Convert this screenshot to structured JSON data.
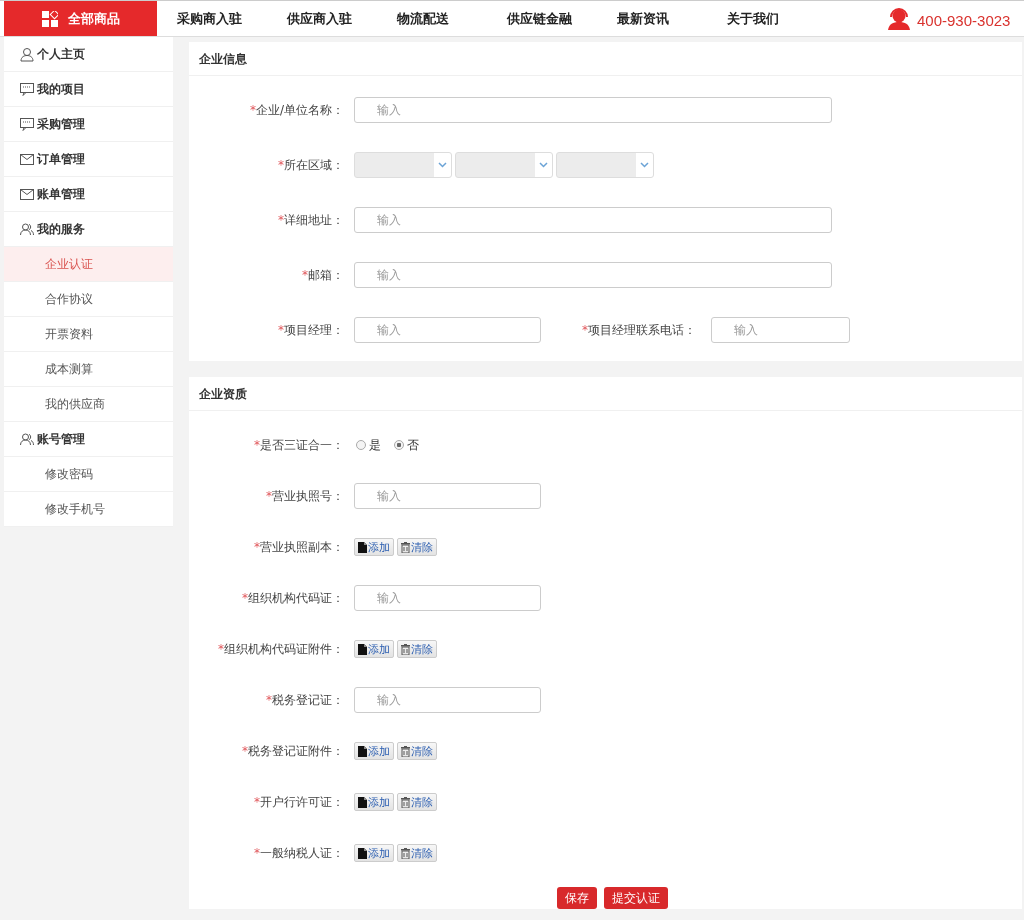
{
  "header": {
    "all_goods": "全部商品",
    "nav": [
      {
        "label": "采购商入驻"
      },
      {
        "label": "供应商入驻"
      },
      {
        "label": "物流配送"
      },
      {
        "label": "供应链金融"
      },
      {
        "label": "最新资讯"
      },
      {
        "label": "关于我们"
      }
    ],
    "phone": "400-930-3023"
  },
  "sidebar": {
    "items": [
      {
        "kind": "user",
        "label": "个人主页",
        "selected": false
      },
      {
        "kind": "board",
        "label": "我的项目",
        "selected": false
      },
      {
        "kind": "board",
        "label": "采购管理",
        "selected": false
      },
      {
        "kind": "mail",
        "label": "订单管理",
        "selected": false
      },
      {
        "kind": "mail",
        "label": "账单管理",
        "selected": false
      },
      {
        "kind": "team",
        "label": "我的服务",
        "selected": false
      },
      {
        "kind": "sub",
        "label": "企业认证",
        "selected": true
      },
      {
        "kind": "sub",
        "label": "合作协议",
        "selected": false
      },
      {
        "kind": "sub",
        "label": "开票资料",
        "selected": false
      },
      {
        "kind": "sub",
        "label": "成本测算",
        "selected": false
      },
      {
        "kind": "sub",
        "label": "我的供应商",
        "selected": false
      },
      {
        "kind": "team",
        "label": "账号管理",
        "selected": false
      },
      {
        "kind": "sub",
        "label": "修改密码",
        "selected": false
      },
      {
        "kind": "sub",
        "label": "修改手机号",
        "selected": false
      }
    ]
  },
  "sections": [
    {
      "title": "企业信息",
      "rows": [
        {
          "kind": "widetext",
          "mark": "*",
          "label": "企业/单位名称：",
          "placeholder": "输入"
        },
        {
          "kind": "selects",
          "mark": "*",
          "label": "所在区域：",
          "selects": [
            {
              "disabled": true
            },
            {
              "disabled": true
            },
            {
              "disabled": true
            }
          ]
        },
        {
          "kind": "widetext",
          "mark": "*",
          "label": "详细地址：",
          "placeholder": "输入"
        },
        {
          "kind": "widetext",
          "mark": "*",
          "label": "邮箱：",
          "placeholder": "输入"
        },
        {
          "kind": "pair",
          "mark": "*",
          "label": "项目经理：",
          "placeholder": "输入",
          "mark2": "*",
          "label2": "项目经理联系电话：",
          "placeholder2": "输入"
        }
      ]
    },
    {
      "title": "企业资质",
      "rows": [
        {
          "kind": "radio",
          "mark": "*",
          "label": "是否三证合一：",
          "options": [
            {
              "label": "是",
              "selected": false
            },
            {
              "label": "否",
              "selected": true
            }
          ]
        },
        {
          "kind": "text",
          "mark": "*",
          "label": "营业执照号：",
          "placeholder": "输入"
        },
        {
          "kind": "upload",
          "mark": "*",
          "label": "营业执照副本：",
          "add": "添加",
          "clear": "清除"
        },
        {
          "kind": "text",
          "mark": "*",
          "label": "组织机构代码证：",
          "placeholder": "输入"
        },
        {
          "kind": "upload",
          "mark": "*",
          "label": "组织机构代码证附件：",
          "add": "添加",
          "clear": "清除"
        },
        {
          "kind": "text",
          "mark": "*",
          "label": "税务登记证：",
          "placeholder": "输入"
        },
        {
          "kind": "upload",
          "mark": "*",
          "label": "税务登记证附件：",
          "add": "添加",
          "clear": "清除"
        },
        {
          "kind": "upload",
          "mark": "*",
          "label": "开户行许可证：",
          "add": "添加",
          "clear": "清除"
        },
        {
          "kind": "upload",
          "mark": "*",
          "label": "一般纳税人证：",
          "add": "添加",
          "clear": "清除"
        }
      ]
    }
  ],
  "actions": [
    {
      "label": "保存"
    },
    {
      "label": "提交认证"
    }
  ]
}
